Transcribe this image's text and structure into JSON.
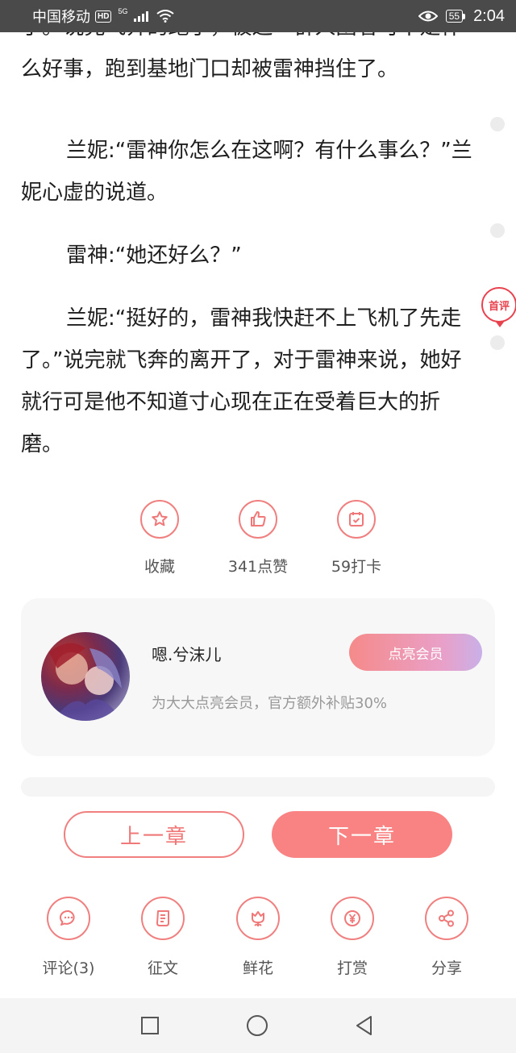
{
  "status_bar": {
    "carrier": "中国移动",
    "hd": "HD",
    "network": "5G",
    "battery": "55",
    "time": "2:04"
  },
  "reading": {
    "paragraphs": [
      "了。”说完飞奔的跑了，被这一群人围着可不是什么好事，跑到基地门口却被雷神挡住了。",
      "兰妮:“雷神你怎么在这啊？有什么事么？”兰妮心虚的说道。",
      "雷神:“她还好么？”",
      "兰妮:“挺好的，雷神我快赶不上飞机了先走了。”说完就飞奔的离开了，对于雷神来说，她好就行可是他不知道寸心现在正在受着巨大的折磨。"
    ],
    "first_comment_marker": "首评"
  },
  "actions": {
    "favorite": "收藏",
    "like": "341点赞",
    "checkin": "59打卡"
  },
  "member": {
    "name": "嗯.兮沫儿",
    "vip_button": "点亮会员",
    "description": "为大大点亮会员，官方额外补贴30%"
  },
  "chapter_nav": {
    "prev": "上一章",
    "next": "下一章"
  },
  "tools": {
    "comment": "评论(3)",
    "essay": "征文",
    "flower": "鲜花",
    "reward": "打赏",
    "share": "分享"
  },
  "colors": {
    "accent": "#f98383",
    "status_bar": "#4a4a4a",
    "first_comment": "#e8424e"
  }
}
